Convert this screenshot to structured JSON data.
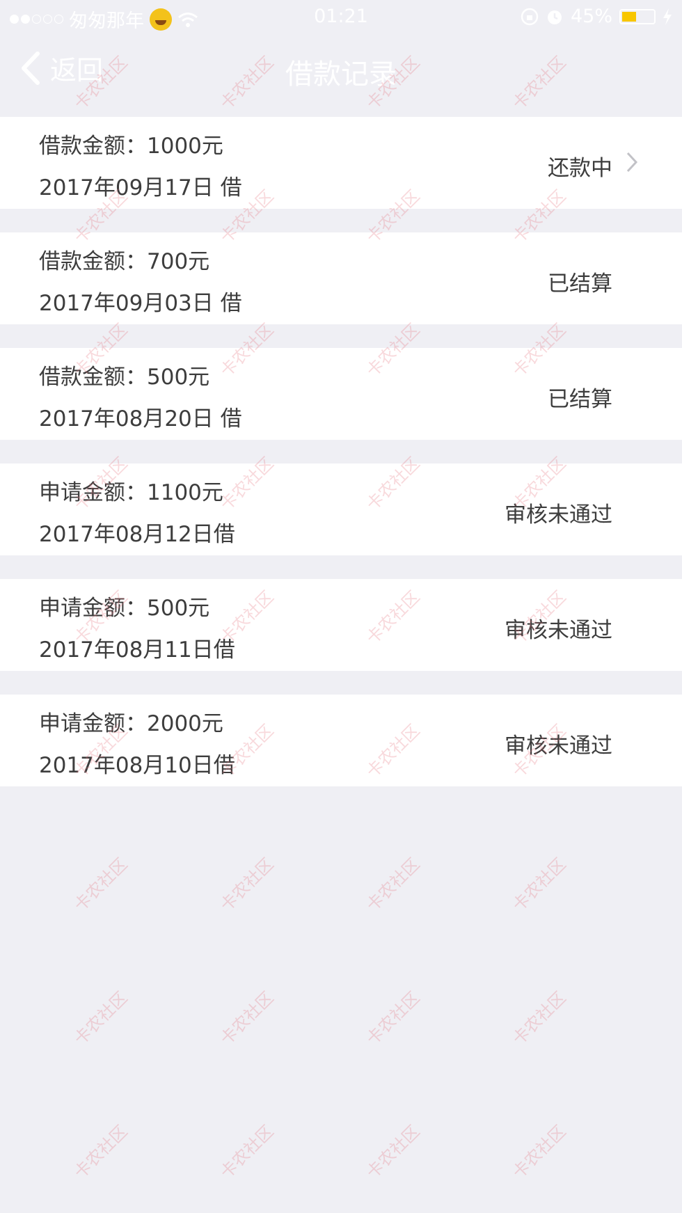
{
  "status_bar": {
    "carrier": "匆匆那年",
    "time": "01:21",
    "battery_percent": "45%",
    "battery_level": 0.45,
    "battery_color": "#f8c600"
  },
  "nav": {
    "back_label": "返回",
    "title": "借款记录"
  },
  "records": [
    {
      "amount": "借款金额：1000元",
      "date": "2017年09月17日 借",
      "status": "还款中",
      "has_chevron": true
    },
    {
      "amount": "借款金额：700元",
      "date": "2017年09月03日 借",
      "status": "已结算",
      "has_chevron": false
    },
    {
      "amount": "借款金额：500元",
      "date": "2017年08月20日 借",
      "status": "已结算",
      "has_chevron": false
    },
    {
      "amount": "申请金额：1100元",
      "date": "2017年08月12日借",
      "status": "审核未通过",
      "has_chevron": false
    },
    {
      "amount": "申请金额：500元",
      "date": "2017年08月11日借",
      "status": "审核未通过",
      "has_chevron": false
    },
    {
      "amount": "申请金额：2000元",
      "date": "2017年08月10日借",
      "status": "审核未通过",
      "has_chevron": false
    }
  ],
  "watermark_text": "卡农社区",
  "colors": {
    "background": "#efeff4",
    "row": "#ffffff",
    "text": "#3d3d3d"
  }
}
